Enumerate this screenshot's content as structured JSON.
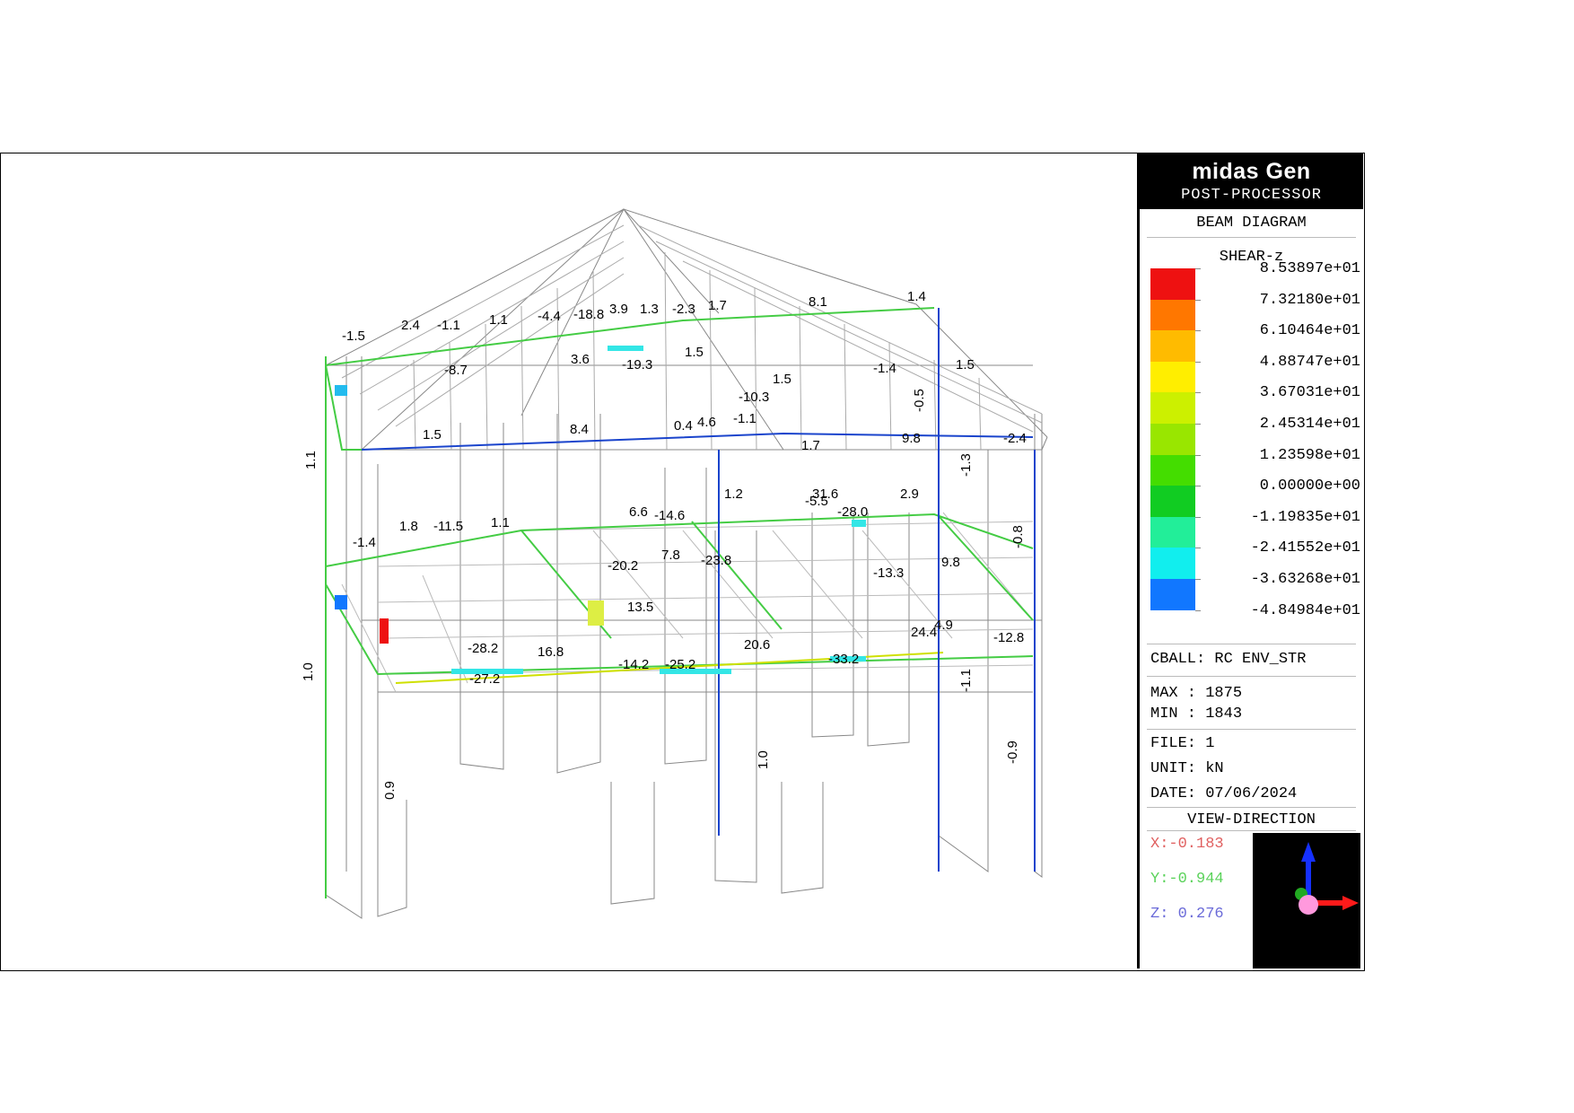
{
  "app": {
    "name": "midas Gen",
    "module": "POST-PROCESSOR"
  },
  "panel": {
    "diagram_type": "BEAM DIAGRAM",
    "component": "SHEAR-z",
    "legend": [
      {
        "value": "8.53897e+01",
        "color": "#ee1111"
      },
      {
        "value": "7.32180e+01",
        "color": "#ff7700"
      },
      {
        "value": "6.10464e+01",
        "color": "#ffbb00"
      },
      {
        "value": "4.88747e+01",
        "color": "#ffee00"
      },
      {
        "value": "3.67031e+01",
        "color": "#ccf000"
      },
      {
        "value": "2.45314e+01",
        "color": "#99e600"
      },
      {
        "value": "1.23598e+01",
        "color": "#44dd00"
      },
      {
        "value": "0.00000e+00",
        "color": "#11cc22"
      },
      {
        "value": "-1.19835e+01",
        "color": "#22ee99"
      },
      {
        "value": "-2.41552e+01",
        "color": "#11eeee"
      },
      {
        "value": "-3.63268e+01",
        "color": "#1177ff"
      },
      {
        "value": "-4.84984e+01",
        "color": null
      }
    ],
    "cball": "CBALL: RC ENV_STR",
    "max": "MAX : 1875",
    "min": "MIN : 1843",
    "file": "FILE: 1",
    "unit": "UNIT: kN",
    "date": "DATE: 07/06/2024",
    "view_direction_title": "VIEW-DIRECTION",
    "view_x": "X:-0.183",
    "view_y": "Y:-0.944",
    "view_z": "Z: 0.276",
    "view_colors": {
      "x": "#e06060",
      "y": "#5ad25a",
      "z": "#6a6ad8"
    }
  },
  "model_labels": [
    "-1.5",
    "2.4",
    "-1.1",
    "1.1",
    "-4.4",
    "-18.8",
    "3.9",
    "1.3",
    "-2.3",
    "1.7",
    "8.1",
    "1.4",
    "-8.7",
    "-19.3",
    "1.5",
    "1.5",
    "-1.4",
    "1.5",
    "1.5",
    "8.4",
    "0.4",
    "4.6",
    "-1.1",
    "1.7",
    "9.8",
    "-2.4",
    "1.1",
    "-1.3",
    "-0.5",
    "1.8",
    "-11.5",
    "1.1",
    "6.6",
    "-14.6",
    "31.6",
    "-28.0",
    "-1.4",
    "7.8",
    "-23.8",
    "-20.2",
    "4.9",
    "-13.3",
    "9.8",
    "-0.8",
    "-12.8",
    "13.5",
    "24.4",
    "-28.2",
    "16.8",
    "-14.2",
    "-25.2",
    "20.6",
    "-33.2",
    "-27.2",
    "1.0",
    "-1.1",
    "0.9",
    "1.0",
    "-0.9",
    "3.6",
    "-10.3",
    "-5.5",
    "2.9",
    "1.2"
  ]
}
